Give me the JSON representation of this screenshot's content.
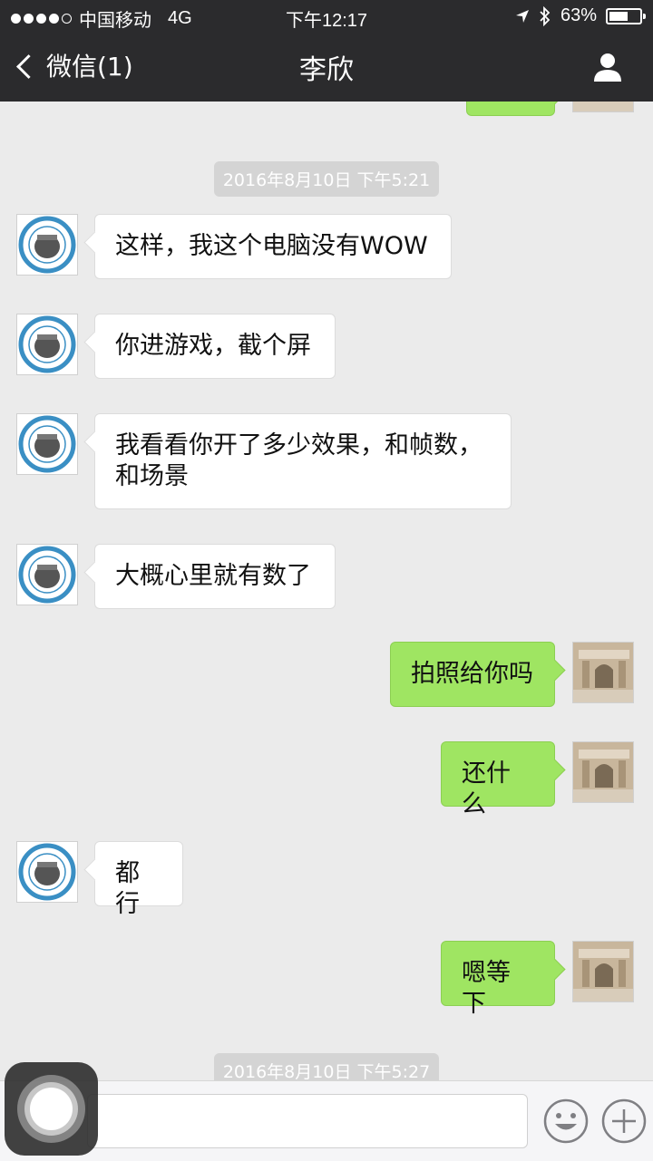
{
  "status_bar": {
    "carrier": "中国移动",
    "network": "4G",
    "time": "下午12:17",
    "battery": "63%",
    "battery_level": 0.63,
    "signal_bars": 4
  },
  "nav": {
    "back_label": "微信(1)",
    "title": "李欣"
  },
  "chat": {
    "timestamps": [
      "2016年8月10日 下午5:21",
      "2016年8月10日 下午5:27"
    ],
    "messages": [
      {
        "side": "in",
        "text": "这样，我这个电脑没有WOW"
      },
      {
        "side": "in",
        "text": "你进游戏，截个屏"
      },
      {
        "side": "in",
        "text": "我看看你开了多少效果，和帧数，和场景"
      },
      {
        "side": "in",
        "text": "大概心里就有数了"
      },
      {
        "side": "out",
        "text": "拍照给你吗"
      },
      {
        "side": "out",
        "text": "还什么"
      },
      {
        "side": "in",
        "text": "都行"
      },
      {
        "side": "out",
        "text": "嗯等下"
      }
    ]
  },
  "icons": {
    "back": "chevron-left-icon",
    "profile": "person-icon",
    "emoji": "smiley-icon",
    "more": "plus-icon",
    "location": "location-arrow-icon",
    "bluetooth": "bluetooth-icon"
  },
  "colors": {
    "nav_bg": "#2b2b2d",
    "chat_bg": "#ebebeb",
    "outgoing_bubble": "#9fe562",
    "incoming_bubble": "#ffffff",
    "timestamp_bg": "#d4d4d4"
  }
}
